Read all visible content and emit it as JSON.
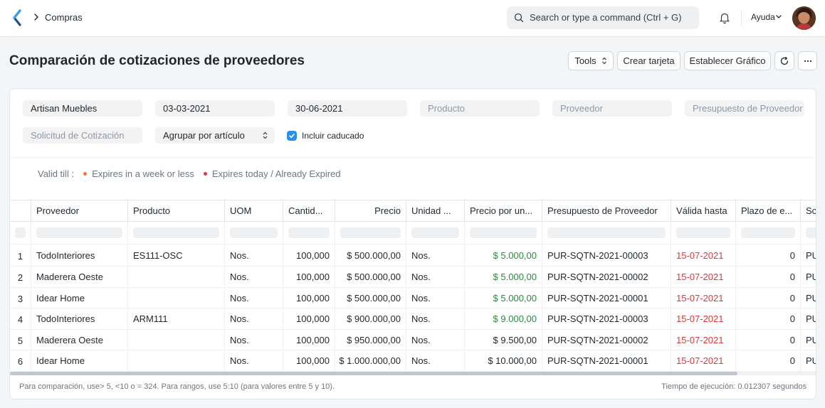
{
  "navbar": {
    "breadcrumb": "Compras",
    "search_placeholder": "Search or type a command (Ctrl + G)",
    "help_label": "Ayuda"
  },
  "page": {
    "title": "Comparación de cotizaciones de proveedores",
    "buttons": {
      "tools": "Tools",
      "create_card": "Crear tarjeta",
      "set_chart": "Establecer Gráfico"
    }
  },
  "filters": {
    "company": "Artisan Muebles",
    "from_date": "03-03-2021",
    "to_date": "30-06-2021",
    "item_placeholder": "Producto",
    "supplier_placeholder": "Proveedor",
    "supplier_quotation_placeholder": "Presupuesto de Proveedor",
    "rfq_placeholder": "Solicitud de Cotización",
    "group_by": "Agrupar por artículo",
    "include_expired_label": "Incluir caducado",
    "include_expired": true
  },
  "legend": {
    "label": "Valid till :",
    "items": [
      {
        "text": "Expires in a week or less",
        "color": "#f5733a"
      },
      {
        "text": "Expires today / Already Expired",
        "color": "#e03636"
      }
    ]
  },
  "table": {
    "columns": [
      "Proveedor",
      "Producto",
      "UOM",
      "Cantid...",
      "Precio",
      "Unidad ...",
      "Precio por un...",
      "Presupuesto de Proveedor",
      "Válida hasta",
      "Plazo de e...",
      "Sc"
    ],
    "rows": [
      {
        "idx": "1",
        "supplier": "TodoInteriores",
        "item": "ES111-OSC",
        "uom": "Nos.",
        "qty": "100,000",
        "price": "$ 500.000,00",
        "stock_uom": "Nos.",
        "price_per_unit": "$ 5.000,00",
        "price_highlight": true,
        "quotation": "PUR-SQTN-2021-00003",
        "valid_till": "15-07-2021",
        "lead_time": "0",
        "extra": "PU"
      },
      {
        "idx": "2",
        "supplier": "Maderera Oeste",
        "item": "",
        "uom": "Nos.",
        "qty": "100,000",
        "price": "$ 500.000,00",
        "stock_uom": "Nos.",
        "price_per_unit": "$ 5.000,00",
        "price_highlight": true,
        "quotation": "PUR-SQTN-2021-00002",
        "valid_till": "15-07-2021",
        "lead_time": "0",
        "extra": "PU"
      },
      {
        "idx": "3",
        "supplier": "Idear Home",
        "item": "",
        "uom": "Nos.",
        "qty": "100,000",
        "price": "$ 500.000,00",
        "stock_uom": "Nos.",
        "price_per_unit": "$ 5.000,00",
        "price_highlight": true,
        "quotation": "PUR-SQTN-2021-00001",
        "valid_till": "15-07-2021",
        "lead_time": "0",
        "extra": "PU"
      },
      {
        "idx": "4",
        "supplier": "TodoInteriores",
        "item": "ARM111",
        "uom": "Nos.",
        "qty": "100,000",
        "price": "$ 900.000,00",
        "stock_uom": "Nos.",
        "price_per_unit": "$ 9.000,00",
        "price_highlight": true,
        "quotation": "PUR-SQTN-2021-00003",
        "valid_till": "15-07-2021",
        "lead_time": "0",
        "extra": "PU"
      },
      {
        "idx": "5",
        "supplier": "Maderera Oeste",
        "item": "",
        "uom": "Nos.",
        "qty": "100,000",
        "price": "$ 950.000,00",
        "stock_uom": "Nos.",
        "price_per_unit": "$ 9.500,00",
        "price_highlight": false,
        "quotation": "PUR-SQTN-2021-00002",
        "valid_till": "15-07-2021",
        "lead_time": "0",
        "extra": "PU"
      },
      {
        "idx": "6",
        "supplier": "Idear Home",
        "item": "",
        "uom": "Nos.",
        "qty": "100,000",
        "price": "$ 1.000.000,00",
        "stock_uom": "Nos.",
        "price_per_unit": "$ 10.000,00",
        "price_highlight": false,
        "quotation": "PUR-SQTN-2021-00001",
        "valid_till": "15-07-2021",
        "lead_time": "0",
        "extra": "PU"
      }
    ]
  },
  "footer": {
    "hint": "Para comparación, use> 5, <10 o = 324. Para rangos, use 5:10 (para valores entre 5 y 10).",
    "execution_time": "Tiempo de ejecución: 0.012307 segundos"
  },
  "colors": {
    "primary": "#2490ef",
    "best_price": "#2b8a3e",
    "expired": "#e03636"
  }
}
